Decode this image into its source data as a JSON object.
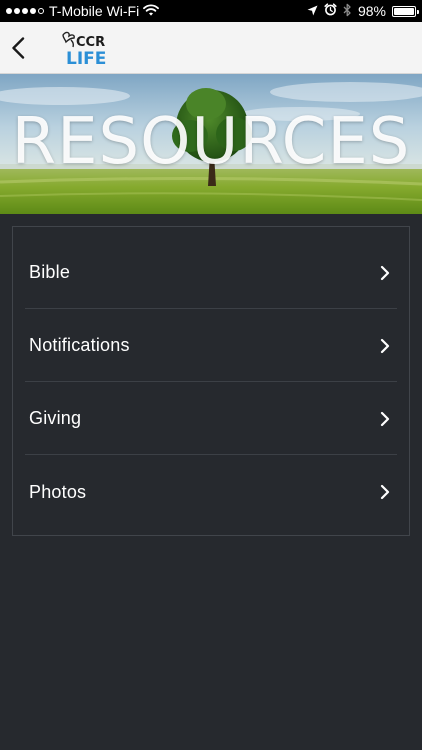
{
  "status_bar": {
    "carrier": "T-Mobile Wi-Fi",
    "battery": "98%",
    "battery_level": 0.98
  },
  "nav": {
    "logo_text_top": "CCR",
    "logo_text_bottom": "LIFE"
  },
  "hero": {
    "title": "RESOURCES"
  },
  "menu": {
    "items": [
      {
        "label": "Bible"
      },
      {
        "label": "Notifications"
      },
      {
        "label": "Giving"
      },
      {
        "label": "Photos"
      }
    ]
  },
  "colors": {
    "background": "#26292e",
    "nav_background": "#f4f4f4",
    "logo_blue": "#2b8fd6",
    "text": "#ffffff"
  }
}
